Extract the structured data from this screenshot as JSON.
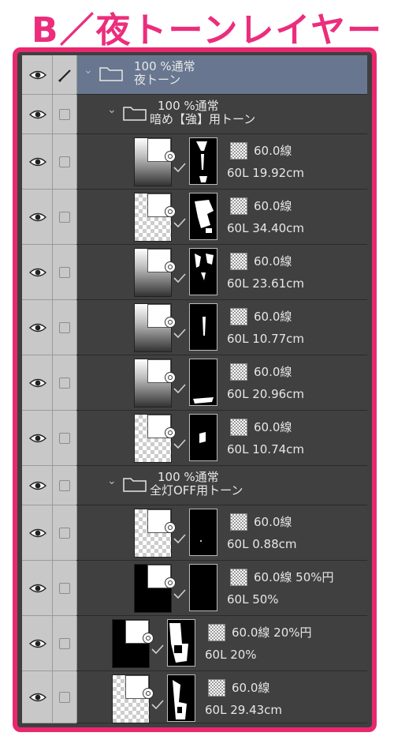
{
  "title": "B／夜トーンレイヤー",
  "colors": {
    "accent": "#e8286e",
    "title": "#ec2d7c",
    "panel": "#404040",
    "selected_row": "#68778f"
  },
  "layers": [
    {
      "kind": "folder",
      "level": 0,
      "selected": true,
      "mode": "100 %通常",
      "name": "夜トーン"
    },
    {
      "kind": "folder",
      "level": 1,
      "mode": "100 %通常",
      "name": "暗め【強】用トーン"
    },
    {
      "kind": "tone",
      "level": 2,
      "lpi": "60.0線",
      "info": "60L 19.92cm",
      "grad": "bw"
    },
    {
      "kind": "tone",
      "level": 2,
      "lpi": "60.0線",
      "info": "60L 34.40cm",
      "grad": "check"
    },
    {
      "kind": "tone",
      "level": 2,
      "lpi": "60.0線",
      "info": "60L 23.61cm",
      "grad": "bw"
    },
    {
      "kind": "tone",
      "level": 2,
      "lpi": "60.0線",
      "info": "60L 10.77cm",
      "grad": "bw"
    },
    {
      "kind": "tone",
      "level": 2,
      "lpi": "60.0線",
      "info": "60L 20.96cm",
      "grad": "bw"
    },
    {
      "kind": "tone",
      "level": 2,
      "lpi": "60.0線",
      "info": "60L 10.74cm",
      "grad": "check"
    },
    {
      "kind": "folder",
      "level": 1,
      "mode": "100 %通常",
      "name": "全灯OFF用トーン"
    },
    {
      "kind": "tone",
      "level": 2,
      "lpi": "60.0線",
      "info": "60L 0.88cm",
      "grad": "check"
    },
    {
      "kind": "tone",
      "level": 2,
      "lpi": "60.0線 50%円",
      "info": "60L 50%",
      "grad": "black"
    },
    {
      "kind": "tone",
      "level": 1,
      "lpi": "60.0線 20%円",
      "info": "60L 20%",
      "grad": "black"
    },
    {
      "kind": "tone",
      "level": 1,
      "lpi": "60.0線",
      "info": "60L 29.43cm",
      "grad": "check"
    }
  ]
}
